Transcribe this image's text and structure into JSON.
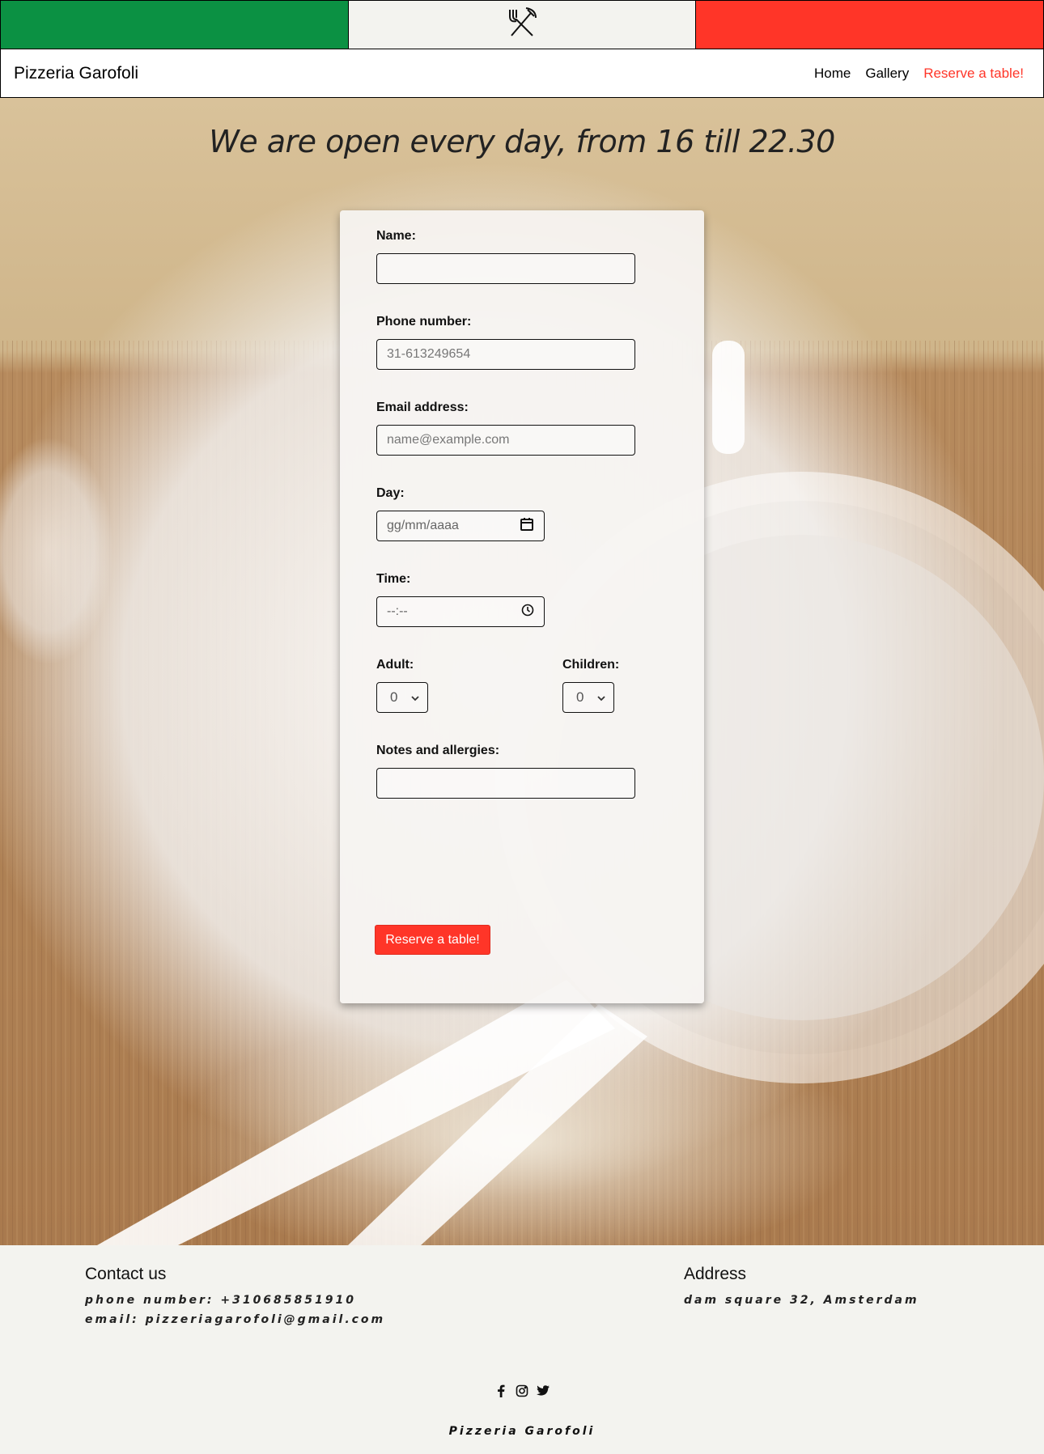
{
  "brand": "Pizzeria Garofoli",
  "nav": {
    "home": "Home",
    "gallery": "Gallery",
    "reserve": "Reserve a table!"
  },
  "hero": {
    "hours": "We are open every day, from 16 till 22.30"
  },
  "form": {
    "name_label": "Name:",
    "name_value": "",
    "phone_label": "Phone number:",
    "phone_placeholder": "31-613249654",
    "email_label": "Email address:",
    "email_placeholder": "name@example.com",
    "day_label": "Day:",
    "day_placeholder": "gg/mm/aaaa",
    "time_label": "Time:",
    "time_placeholder": "--:--",
    "adult_label": "Adult:",
    "adult_value": "0",
    "children_label": "Children:",
    "children_value": "0",
    "notes_label": "Notes and allergies:",
    "notes_value": "",
    "submit_label": "Reserve a table!"
  },
  "footer": {
    "contact_title": "Contact us",
    "phone": "phone number: +310685851910",
    "email": "email: pizzeriagarofoli@gmail.com",
    "address_title": "Address",
    "address": "dam square 32, Amsterdam",
    "brand": "Pizzeria Garofoli"
  },
  "icons": [
    "cutlery-icon",
    "facebook-icon",
    "instagram-icon",
    "twitter-icon",
    "calendar-icon",
    "clock-icon",
    "chevron-down-icon"
  ],
  "colors": {
    "flag_green": "#0b9143",
    "flag_white": "#f3f3ef",
    "flag_red": "#ff3528",
    "accent": "#ff3528"
  }
}
